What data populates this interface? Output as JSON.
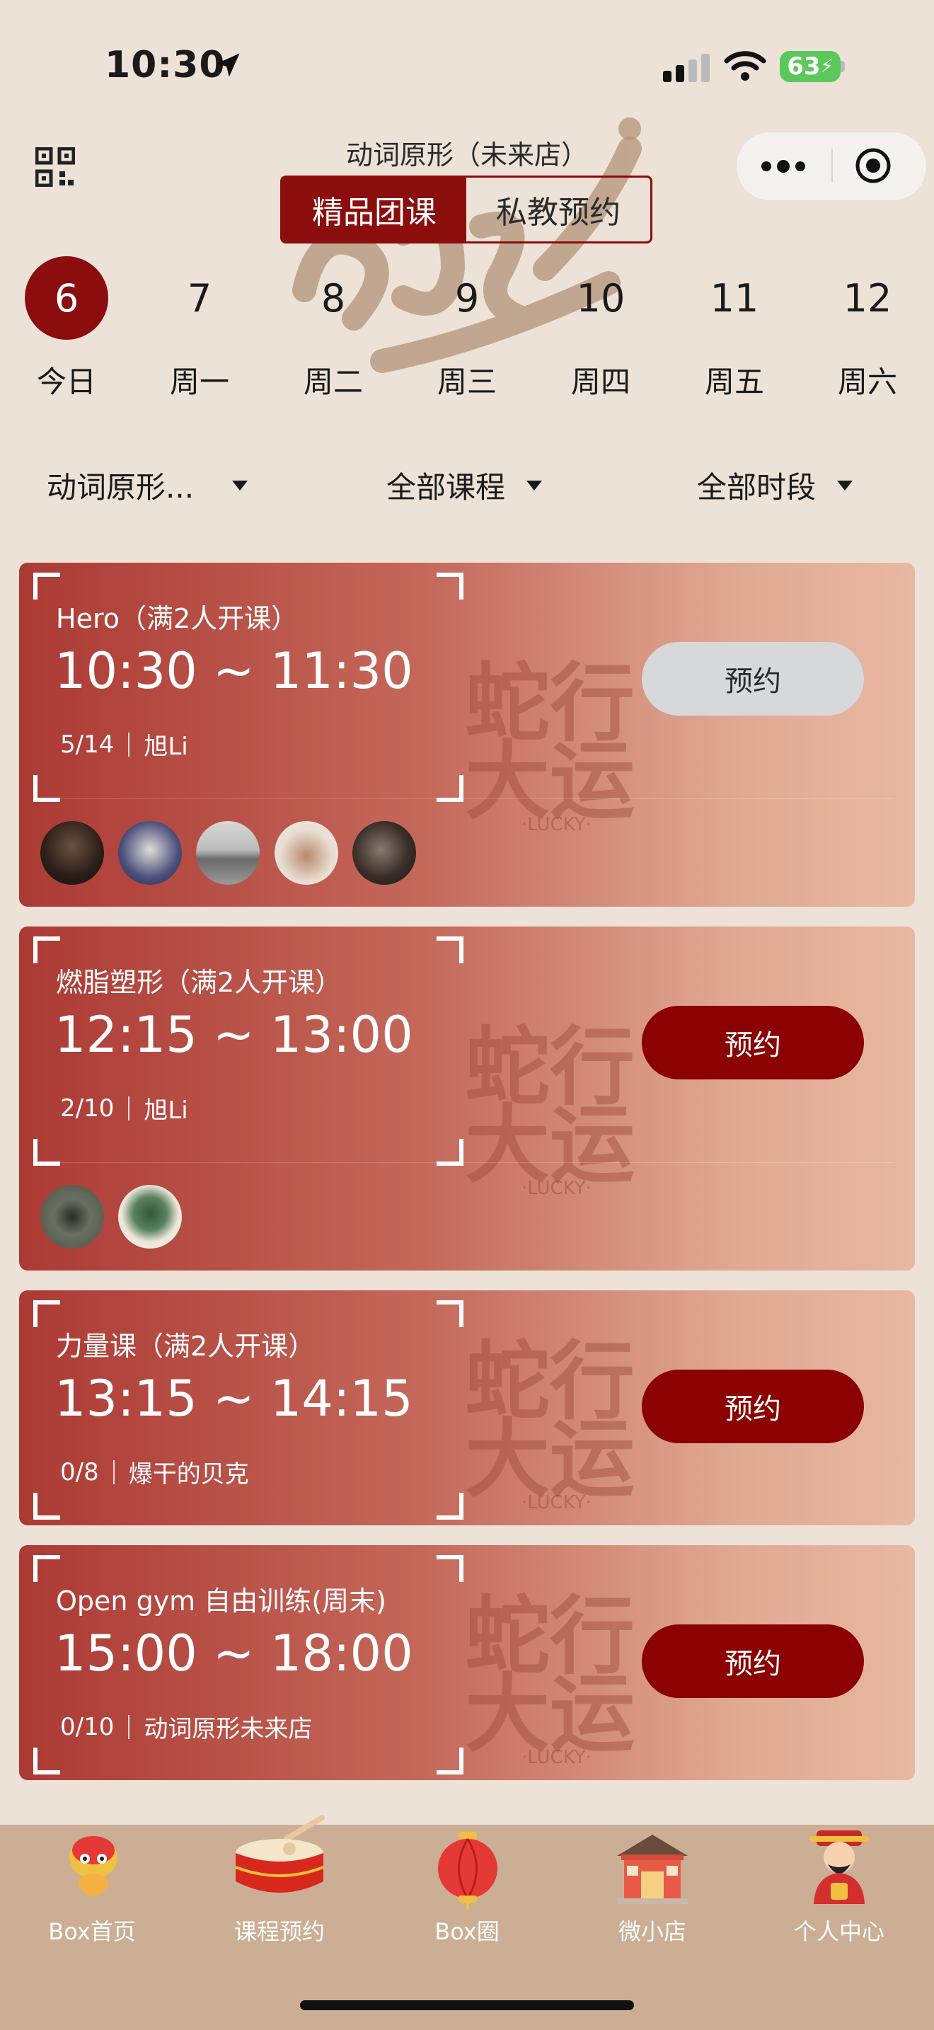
{
  "status": {
    "time": "10:30",
    "battery": "63"
  },
  "header": {
    "store_title": "动词原形（未来店）",
    "segments": [
      {
        "label": "精品团课",
        "active": true
      },
      {
        "label": "私教预约",
        "active": false
      }
    ]
  },
  "dates": [
    {
      "num": "6",
      "week": "今日",
      "selected": true
    },
    {
      "num": "7",
      "week": "周一"
    },
    {
      "num": "8",
      "week": "周二"
    },
    {
      "num": "9",
      "week": "周三"
    },
    {
      "num": "10",
      "week": "周四"
    },
    {
      "num": "11",
      "week": "周五"
    },
    {
      "num": "12",
      "week": "周六"
    }
  ],
  "filters": {
    "store": "动词原形...",
    "course": "全部课程",
    "period": "全部时段"
  },
  "classes": [
    {
      "name": "Hero（满2人开课）",
      "time": "10:30 ~ 11:30",
      "count": "5/14",
      "coach": "旭Li",
      "button": "预约",
      "button_state": "disabled"
    },
    {
      "name": "燃脂塑形（满2人开课）",
      "time": "12:15 ~ 13:00",
      "count": "2/10",
      "coach": "旭Li",
      "button": "预约",
      "button_state": "active"
    },
    {
      "name": "力量课（满2人开课）",
      "time": "13:15 ~ 14:15",
      "count": "0/8",
      "coach": "爆干的贝克",
      "button": "预约",
      "button_state": "active"
    },
    {
      "name": "Open gym 自由训练(周末)",
      "time": "15:00 ~ 18:00",
      "count": "0/10",
      "coach": "动词原形未来店",
      "button": "预约",
      "button_state": "active"
    }
  ],
  "tabs": [
    {
      "label": "Box首页",
      "icon": "lion-dance-icon"
    },
    {
      "label": "课程预约",
      "icon": "drum-icon"
    },
    {
      "label": "Box圈",
      "icon": "lantern-icon"
    },
    {
      "label": "微小店",
      "icon": "shop-icon"
    },
    {
      "label": "个人中心",
      "icon": "fortune-god-icon"
    }
  ],
  "colors": {
    "accent": "#8b0d0d",
    "background": "#ece2d8",
    "tabbar": "#cbae93",
    "button_disabled": "#d7d8da"
  }
}
